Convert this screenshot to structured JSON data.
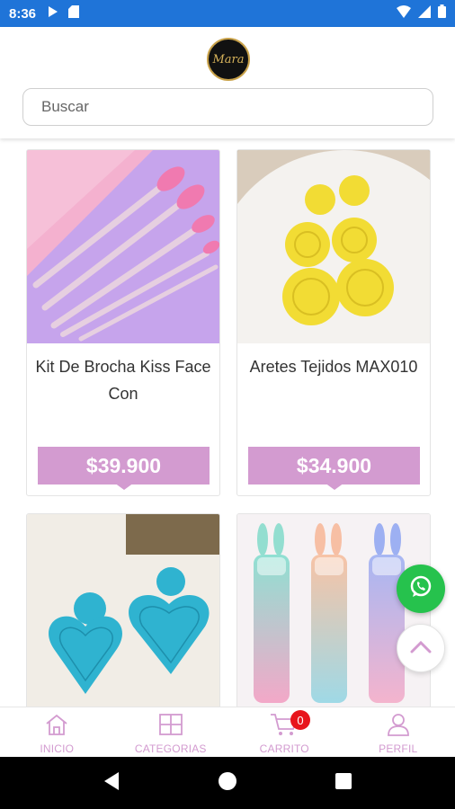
{
  "status_bar": {
    "time": "8:36"
  },
  "header": {
    "logo_text": "Mara"
  },
  "search": {
    "placeholder": "Buscar"
  },
  "products": [
    {
      "title": "Kit De Brocha Kiss Face Con",
      "price": "$39.900",
      "image": "makeup-brushes"
    },
    {
      "title": "Aretes Tejidos MAX010",
      "price": "$34.900",
      "image": "yellow-beaded-earrings"
    },
    {
      "title": "",
      "price": "",
      "image": "turquoise-heart-earrings"
    },
    {
      "title": "",
      "price": "",
      "image": "bunny-bottles"
    }
  ],
  "bottom_nav": {
    "items": [
      {
        "label": "INICIO",
        "icon": "home-icon"
      },
      {
        "label": "CATEGORIAS",
        "icon": "grid-icon"
      },
      {
        "label": "CARRITO",
        "icon": "cart-icon",
        "badge": "0"
      },
      {
        "label": "PERFIL",
        "icon": "user-icon"
      }
    ]
  },
  "colors": {
    "accent": "#d39bd0",
    "status_bar": "#1f74d8",
    "whatsapp": "#26c24d",
    "badge": "#e8151c"
  }
}
